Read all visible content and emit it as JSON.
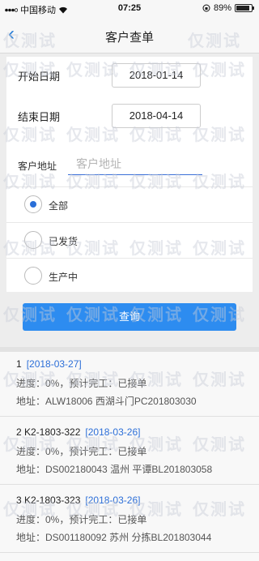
{
  "status_bar": {
    "carrier": "中国移动",
    "time": "07:25",
    "battery_text": "89%",
    "battery_level": 0.89,
    "signal_icon": "signal-icon",
    "wifi_icon": "wifi-icon",
    "lock_icon": "orientation-lock-icon"
  },
  "nav": {
    "back_glyph": "‹",
    "title": "客户查单"
  },
  "form": {
    "start_label": "开始日期",
    "start_value": "2018-01-14",
    "end_label": "结束日期",
    "end_value": "2018-04-14",
    "address_label": "客户地址",
    "address_placeholder": "客户地址"
  },
  "filters": [
    {
      "label": "全部",
      "checked": true
    },
    {
      "label": "已发货",
      "checked": false
    },
    {
      "label": "生产中",
      "checked": false
    }
  ],
  "query_button": "查询",
  "results": [
    {
      "head": "1",
      "date": "[2018-03-27]",
      "progress": "进度：0%，预计完工：已接单",
      "address": "地址：ALW18006 西湖斗门PC201803030"
    },
    {
      "head": "2 K2-1803-322",
      "date": "[2018-03-26]",
      "progress": "进度：0%，预计完工：已接单",
      "address": "地址：DS002180043 温州 平谭BL201803058"
    },
    {
      "head": "3 K2-1803-323",
      "date": "[2018-03-26]",
      "progress": "进度：0%，预计完工：已接单",
      "address": "地址：DS001180092 苏州 分拣BL201803044"
    }
  ],
  "watermark_text": "仅测试",
  "colors": {
    "accent": "#2d8cf0",
    "link_date": "#2d6fd8",
    "background": "#ededed"
  }
}
